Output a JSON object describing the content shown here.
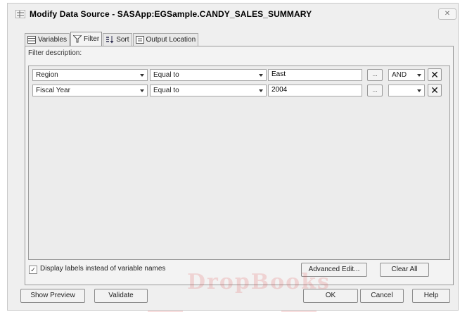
{
  "window": {
    "title": "Modify Data Source - SASApp:EGSample.CANDY_SALES_SUMMARY",
    "close_label": "✕"
  },
  "tabs": [
    {
      "label": "Variables",
      "icon": "table-icon",
      "active": false
    },
    {
      "label": "Filter",
      "icon": "funnel-icon",
      "active": true
    },
    {
      "label": "Sort",
      "icon": "sort-icon",
      "active": false
    },
    {
      "label": "Output Location",
      "icon": "output-icon",
      "active": false
    }
  ],
  "filter": {
    "description_label": "Filter description:",
    "rows": [
      {
        "variable": "Region",
        "operator": "Equal to",
        "value": "East",
        "ellipsis": "...",
        "connector": "AND",
        "remove": "✕"
      },
      {
        "variable": "Fiscal Year",
        "operator": "Equal to",
        "value": "2004",
        "ellipsis": "...",
        "connector": "",
        "remove": "✕"
      }
    ]
  },
  "options": {
    "display_labels": "Display labels instead of variable names",
    "display_labels_checked": true,
    "checkmark": "✓"
  },
  "buttons": {
    "advanced_edit": "Advanced Edit...",
    "clear_all": "Clear All",
    "show_preview": "Show Preview",
    "validate": "Validate",
    "ok": "OK",
    "cancel": "Cancel",
    "help": "Help"
  },
  "watermark": "DropBooks",
  "colors": {
    "accent": "#5ec8e0",
    "watermark_red": "#e04848",
    "selected_tab_bg": "#f4f4f4"
  }
}
